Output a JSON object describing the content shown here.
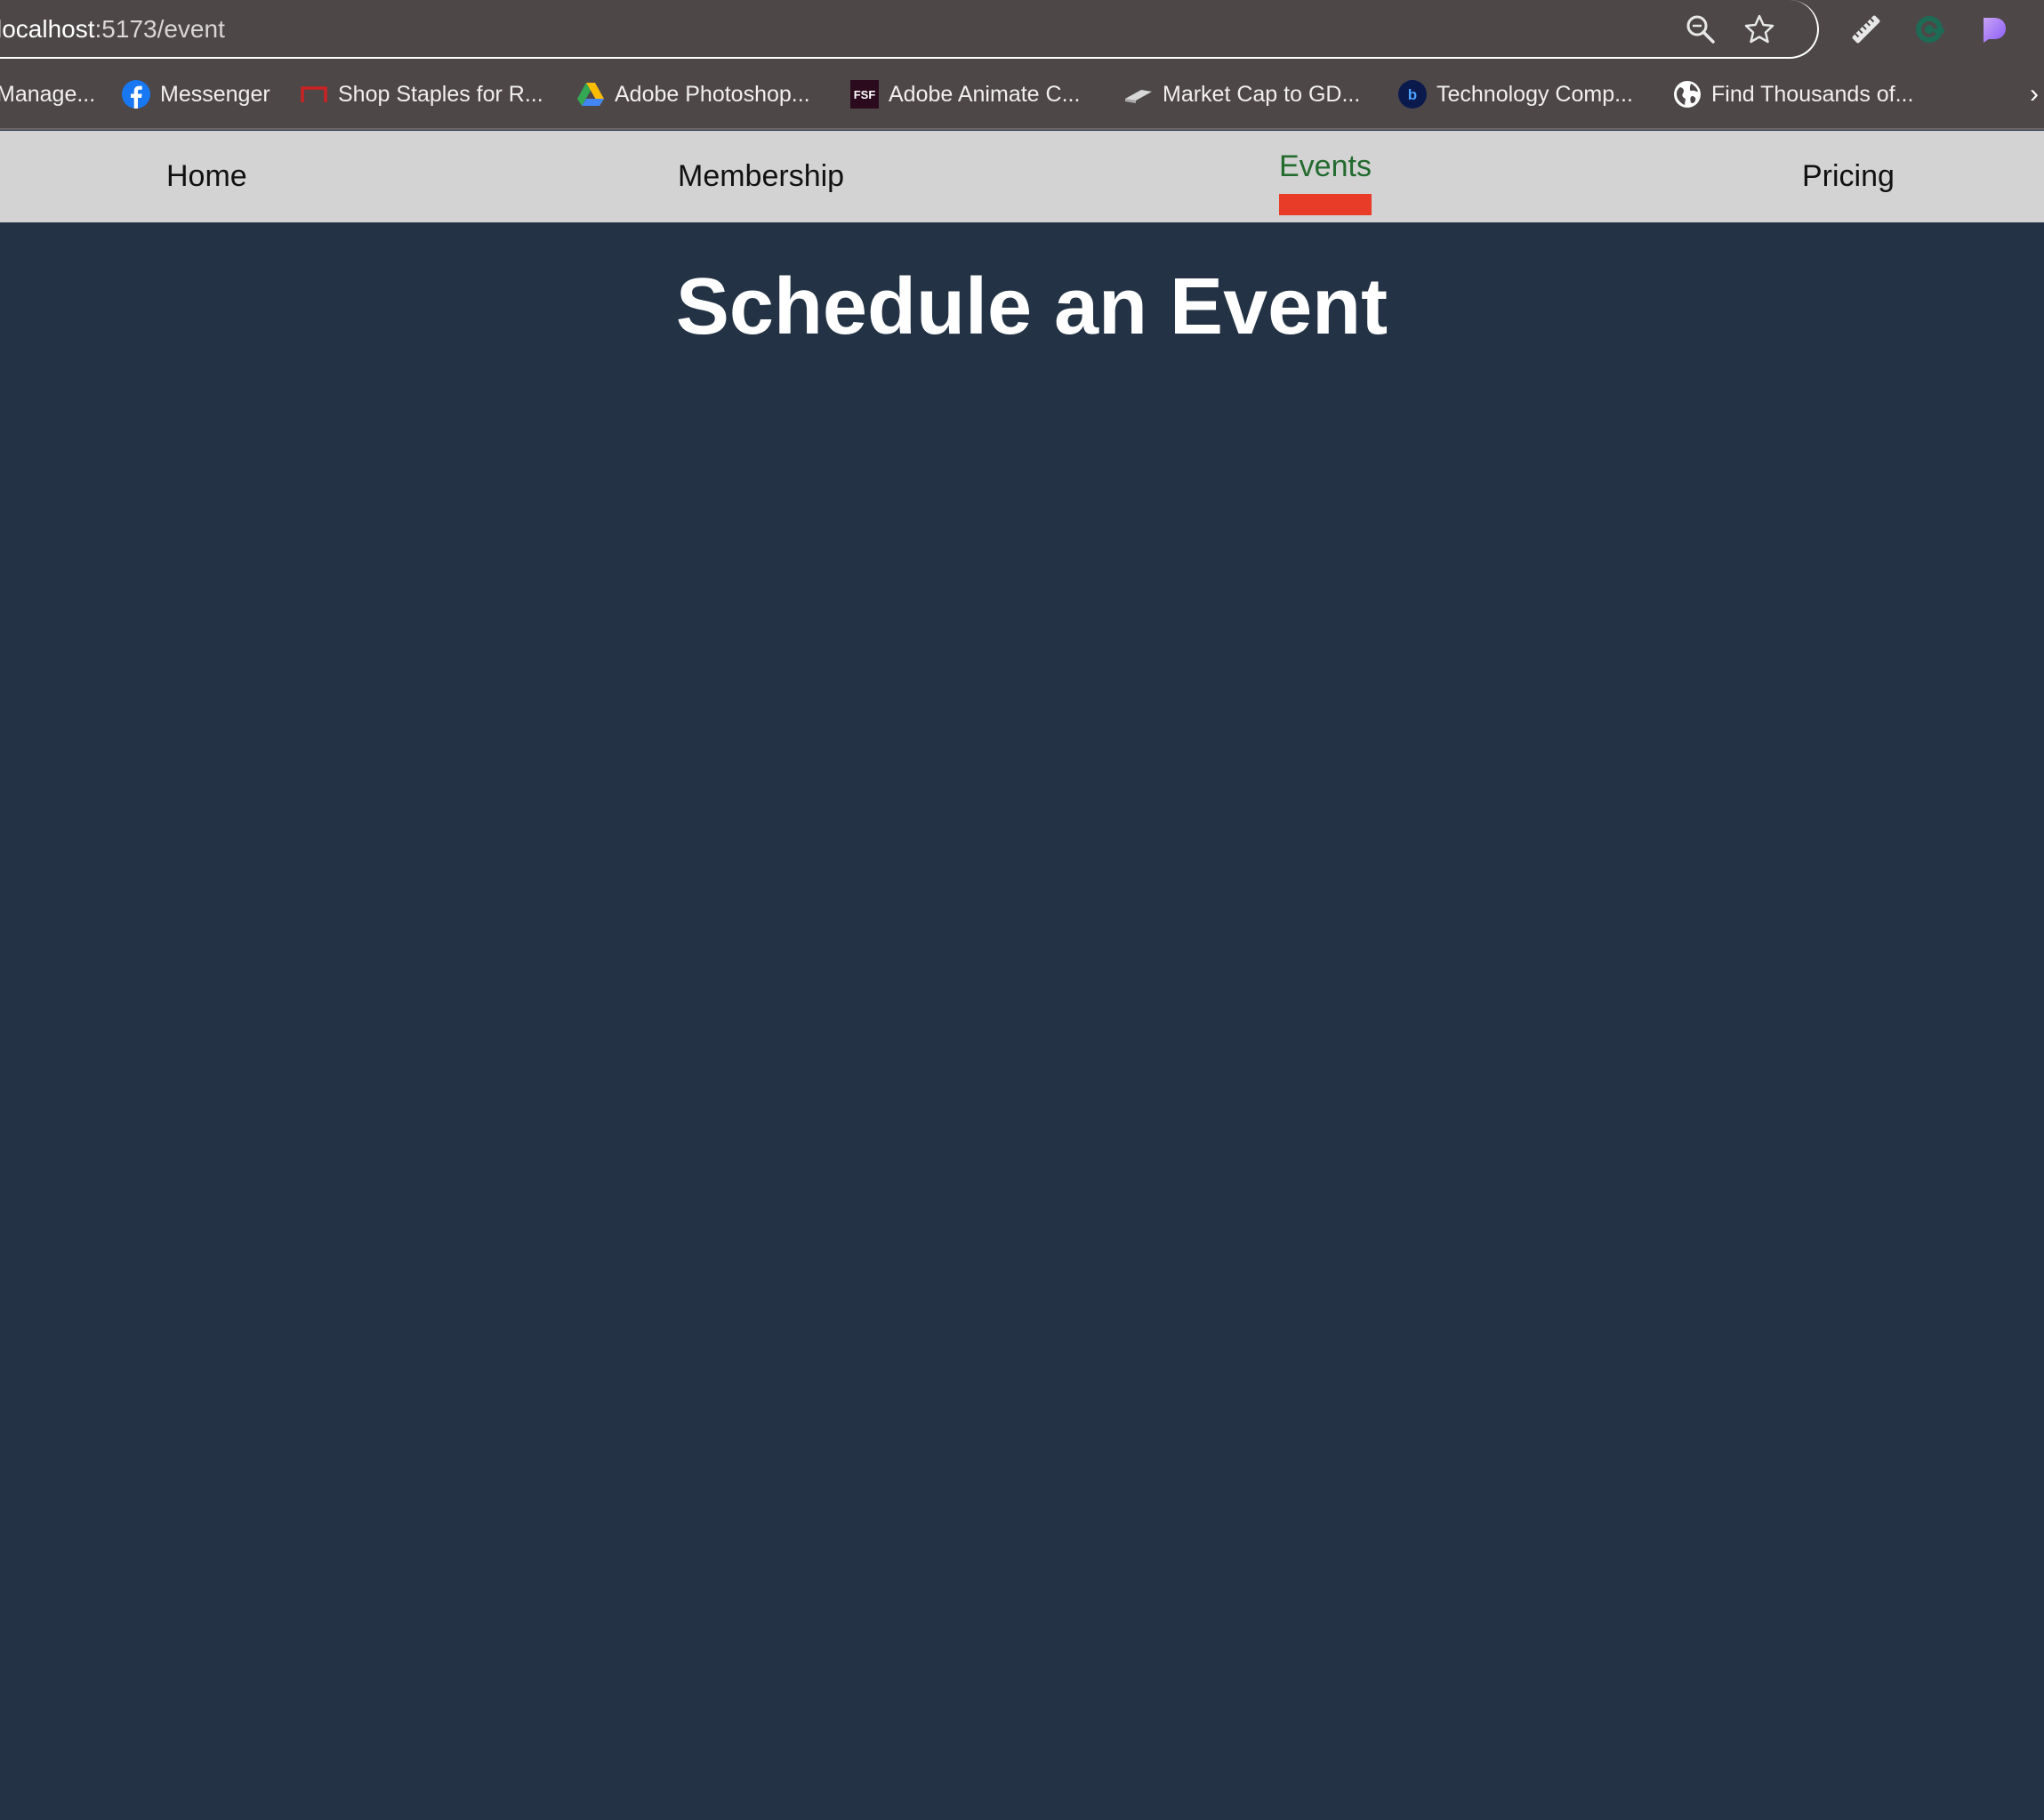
{
  "browser": {
    "url_host": "localhost",
    "url_path": ":5173/event",
    "icons": {
      "zoom": "zoom-icon",
      "bookmark_star": "star-icon",
      "extension_ruler": "ruler-icon",
      "extension_grammarly": "grammarly-icon",
      "extension_purple": "extension-icon"
    }
  },
  "bookmarks": {
    "items": [
      {
        "label": "Manage...",
        "icon": "none"
      },
      {
        "label": "Messenger",
        "icon": "facebook-icon"
      },
      {
        "label": "Shop Staples for R...",
        "icon": "staples-icon"
      },
      {
        "label": "Adobe Photoshop...",
        "icon": "google-drive-icon"
      },
      {
        "label": "Adobe Animate C...",
        "icon": "fsf-icon"
      },
      {
        "label": "Market Cap to GD...",
        "icon": "market-icon"
      },
      {
        "label": "Technology Comp...",
        "icon": "b-icon"
      },
      {
        "label": "Find Thousands of...",
        "icon": "globe-icon"
      }
    ],
    "more": "›"
  },
  "nav": {
    "home": "Home",
    "membership": "Membership",
    "events": "Events",
    "pricing": "Pricing",
    "active": "Events",
    "active_color": "#236b2f",
    "indicator_color": "#e83c28"
  },
  "main": {
    "title": "Schedule an Event",
    "background": "#233345"
  }
}
